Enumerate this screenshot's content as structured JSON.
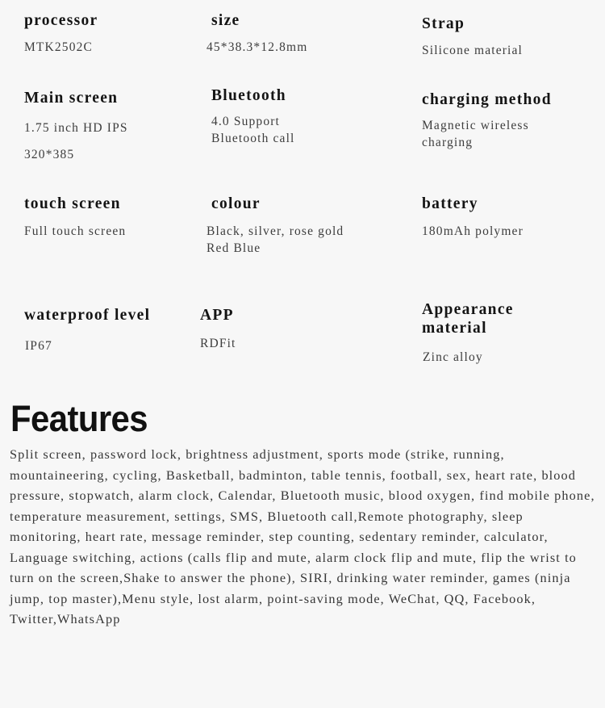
{
  "colors": {
    "background": "#f7f7f7",
    "label_text": "#141414",
    "value_text": "#3d3d3d",
    "heading_text": "#111111",
    "body_text": "#363636"
  },
  "spec_sheet": {
    "rows": [
      [
        {
          "label": "processor",
          "value": "MTK2502C"
        },
        {
          "label": "size",
          "value": "45*38.3*12.8mm"
        },
        {
          "label": "Strap",
          "value": "Silicone material"
        }
      ],
      [
        {
          "label": "Main screen",
          "value": "1.75 inch HD IPS\n320*385"
        },
        {
          "label": "Bluetooth",
          "value": "4.0 Support\nBluetooth call"
        },
        {
          "label": "charging method",
          "value": "Magnetic wireless\ncharging"
        }
      ],
      [
        {
          "label": "touch screen",
          "value": "Full touch screen"
        },
        {
          "label": "colour",
          "value": "Black, silver, rose gold\nRed Blue"
        },
        {
          "label": "battery",
          "value": "180mAh polymer"
        }
      ],
      [
        {
          "label": "waterproof level",
          "value": "IP67"
        },
        {
          "label": "APP",
          "value": "RDFit"
        },
        {
          "label": "Appearance\nmaterial",
          "value": "Zinc alloy"
        }
      ]
    ]
  },
  "features": {
    "heading": "Features",
    "body": "Split screen, password lock, brightness adjustment, sports mode (strike, running, mountaineering, cycling, Basketball, badminton, table tennis, football, sex, heart rate, blood pressure, stopwatch, alarm clock, Calendar, Bluetooth music, blood oxygen, find mobile phone, temperature measurement, settings, SMS, Bluetooth call,Remote photography, sleep monitoring, heart rate, message reminder, step counting, sedentary reminder, calculator, Language switching, actions (calls flip and mute, alarm clock flip and mute, flip the wrist to turn on the screen,Shake to answer the phone), SIRI, drinking water reminder, games (ninja jump, top master),Menu style, lost alarm, point-saving mode, WeChat, QQ, Facebook, Twitter,WhatsApp"
  }
}
